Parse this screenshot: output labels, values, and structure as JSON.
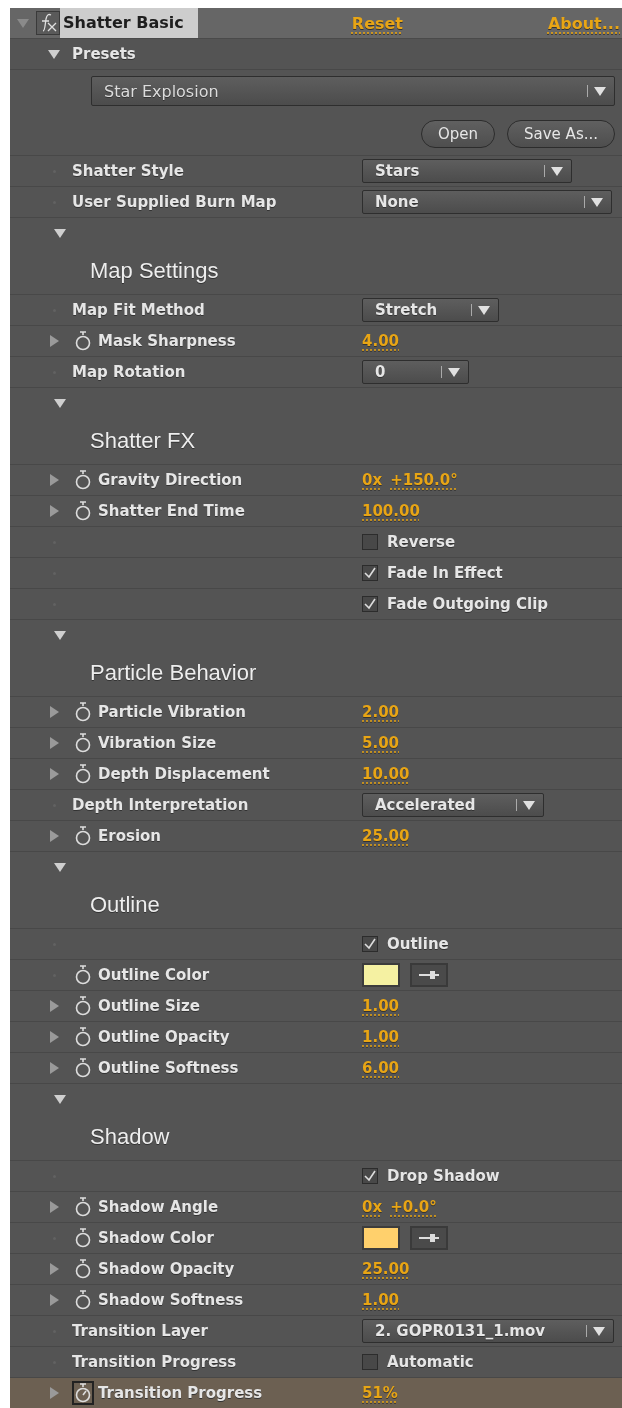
{
  "effect": {
    "name": "Shatter Basic",
    "reset": "Reset",
    "about": "About...",
    "expanded": true
  },
  "presets": {
    "label": "Presets",
    "expanded": true,
    "value": "Star Explosion",
    "buttons": [
      "Open",
      "Save As..."
    ]
  },
  "rows": [
    {
      "kind": "dropdown",
      "label": "Shatter Style",
      "value": "Stars",
      "expandable": false,
      "stopwatch": false,
      "selected": false
    },
    {
      "kind": "dropdown",
      "label": "User Supplied Burn Map",
      "value": "None",
      "expandable": false,
      "stopwatch": false,
      "selected": false
    },
    {
      "kind": "section",
      "title": "Map Settings",
      "expanded": true
    },
    {
      "kind": "dropdown",
      "label": "Map Fit Method",
      "value": "Stretch",
      "expandable": false,
      "stopwatch": false,
      "selected": false
    },
    {
      "kind": "number",
      "label": "Mask Sharpness",
      "value": "4.00",
      "expandable": true,
      "stopwatch": true,
      "selected": false
    },
    {
      "kind": "dropdown",
      "label": "Map Rotation",
      "value": "0",
      "expandable": false,
      "stopwatch": false,
      "selected": false
    },
    {
      "kind": "section",
      "title": "Shatter FX",
      "expanded": true
    },
    {
      "kind": "angle",
      "label": "Gravity Direction",
      "turns": "0x",
      "degrees": "+150.0°",
      "expandable": true,
      "stopwatch": true,
      "selected": false
    },
    {
      "kind": "number",
      "label": "Shatter End Time",
      "value": "100.00",
      "expandable": true,
      "stopwatch": true,
      "selected": false
    },
    {
      "kind": "checkbox",
      "text": "Reverse",
      "checked": false,
      "expandable": false,
      "stopwatch": false,
      "selected": false
    },
    {
      "kind": "checkbox",
      "text": "Fade In Effect",
      "checked": true,
      "expandable": false,
      "stopwatch": false,
      "selected": false
    },
    {
      "kind": "checkbox",
      "text": "Fade Outgoing Clip",
      "checked": true,
      "expandable": false,
      "stopwatch": false,
      "selected": false
    },
    {
      "kind": "section",
      "title": "Particle Behavior",
      "expanded": true
    },
    {
      "kind": "number",
      "label": "Particle Vibration",
      "value": "2.00",
      "expandable": true,
      "stopwatch": true,
      "selected": false
    },
    {
      "kind": "number",
      "label": "Vibration Size",
      "value": "5.00",
      "expandable": true,
      "stopwatch": true,
      "selected": false
    },
    {
      "kind": "number",
      "label": "Depth Displacement",
      "value": "10.00",
      "expandable": true,
      "stopwatch": true,
      "selected": false
    },
    {
      "kind": "dropdown",
      "label": "Depth Interpretation",
      "value": "Accelerated",
      "expandable": false,
      "stopwatch": false,
      "selected": false
    },
    {
      "kind": "number",
      "label": "Erosion",
      "value": "25.00",
      "expandable": true,
      "stopwatch": true,
      "selected": false
    },
    {
      "kind": "section",
      "title": "Outline",
      "expanded": true
    },
    {
      "kind": "checkbox",
      "text": "Outline",
      "checked": true,
      "expandable": false,
      "stopwatch": false,
      "selected": false
    },
    {
      "kind": "color",
      "label": "Outline Color",
      "color": "#f5f1a2",
      "expandable": false,
      "stopwatch": true,
      "selected": false
    },
    {
      "kind": "number",
      "label": "Outline Size",
      "value": "1.00",
      "expandable": true,
      "stopwatch": true,
      "selected": false
    },
    {
      "kind": "number",
      "label": "Outline Opacity",
      "value": "1.00",
      "expandable": true,
      "stopwatch": true,
      "selected": false
    },
    {
      "kind": "number",
      "label": "Outline Softness",
      "value": "6.00",
      "expandable": true,
      "stopwatch": true,
      "selected": false
    },
    {
      "kind": "section",
      "title": "Shadow",
      "expanded": true
    },
    {
      "kind": "checkbox",
      "text": "Drop Shadow",
      "checked": true,
      "expandable": false,
      "stopwatch": false,
      "selected": false
    },
    {
      "kind": "angle",
      "label": "Shadow Angle",
      "turns": "0x",
      "degrees": "+0.0°",
      "expandable": true,
      "stopwatch": true,
      "selected": false
    },
    {
      "kind": "color",
      "label": "Shadow Color",
      "color": "#ffd06c",
      "expandable": false,
      "stopwatch": true,
      "selected": false
    },
    {
      "kind": "number",
      "label": "Shadow Opacity",
      "value": "25.00",
      "expandable": true,
      "stopwatch": true,
      "selected": false
    },
    {
      "kind": "number",
      "label": "Shadow Softness",
      "value": "1.00",
      "expandable": true,
      "stopwatch": true,
      "selected": false
    },
    {
      "kind": "dropdown",
      "label": "Transition Layer",
      "value": "2. GOPR0131_1.mov",
      "expandable": false,
      "stopwatch": false,
      "selected": false
    },
    {
      "kind": "checkbox",
      "label": "Transition Progress",
      "text": "Automatic",
      "checked": false,
      "expandable": false,
      "stopwatch": false,
      "selected": false
    },
    {
      "kind": "number",
      "label": "Transition Progress",
      "value": "51%",
      "expandable": true,
      "stopwatch": true,
      "selected": true
    }
  ]
}
